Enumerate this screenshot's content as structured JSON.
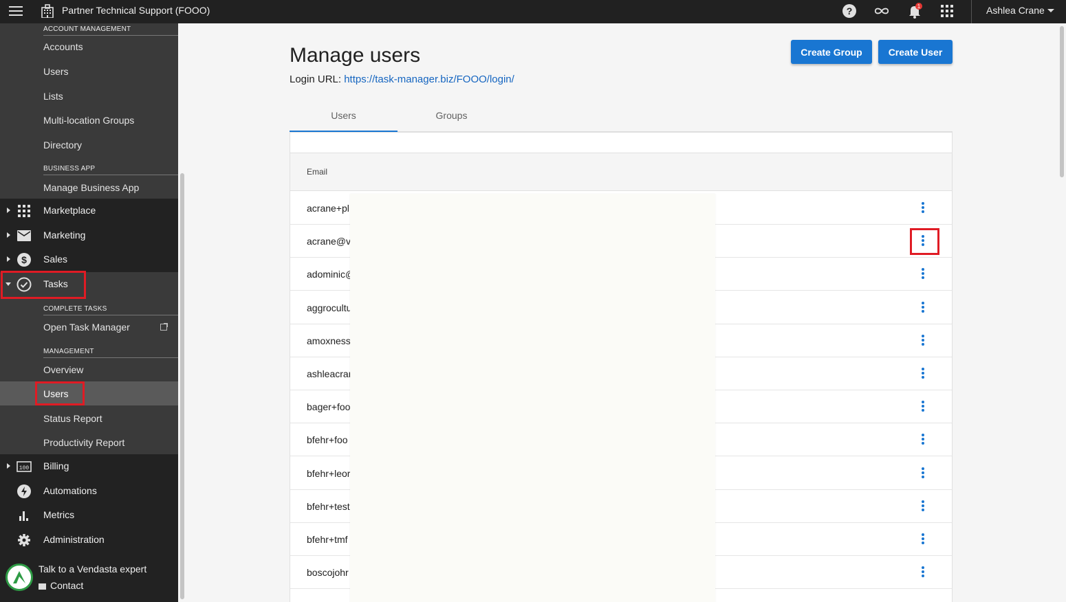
{
  "topbar": {
    "title": "Partner Technical Support (FOOO)",
    "user_name": "Ashlea Crane",
    "notification_count": "1",
    "icons": [
      "menu-icon",
      "building-icon",
      "help-icon",
      "infinity-icon",
      "bell-icon",
      "apps-grid-icon"
    ]
  },
  "sidebar": {
    "sections": {
      "account_management": "ACCOUNT MANAGEMENT",
      "business_app": "BUSINESS APP",
      "complete_tasks": "COMPLETE TASKS",
      "management": "MANAGEMENT"
    },
    "account_items": [
      "Accounts",
      "Users",
      "Lists",
      "Multi-location Groups",
      "Directory"
    ],
    "business_items": [
      "Manage Business App"
    ],
    "main_items": {
      "marketplace": "Marketplace",
      "marketing": "Marketing",
      "sales": "Sales",
      "tasks": "Tasks",
      "billing": "Billing",
      "automations": "Automations",
      "metrics": "Metrics",
      "administration": "Administration"
    },
    "tasks_items": {
      "open_task_manager": "Open Task Manager",
      "overview": "Overview",
      "users": "Users",
      "status_report": "Status Report",
      "productivity_report": "Productivity Report"
    },
    "footer": {
      "talk": "Talk to a Vendasta expert",
      "contact": "Contact"
    }
  },
  "main": {
    "title": "Manage users",
    "login_label": "Login URL:",
    "login_url": "https://task-manager.biz/FOOO/login/",
    "buttons": {
      "create_group": "Create Group",
      "create_user": "Create User"
    },
    "tabs": [
      "Users",
      "Groups"
    ],
    "table": {
      "column_email": "Email",
      "rows": [
        "acrane+pl",
        "acrane@v",
        "adominic@",
        "aggrocultu",
        "amoxness",
        "ashleacrar",
        "bager+foo",
        "bfehr+foo",
        "bfehr+leor",
        "bfehr+test",
        "bfehr+tmf",
        "boscojohr"
      ]
    }
  },
  "colors": {
    "accent": "#1976d2",
    "highlight": "#e01b24",
    "topbar": "#212121",
    "sidebar": "#3a3a3a"
  }
}
